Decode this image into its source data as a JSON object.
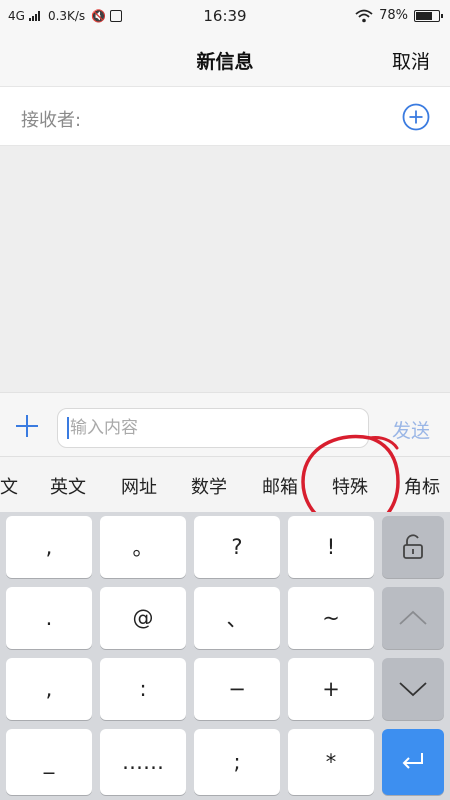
{
  "status_bar": {
    "network": "4G",
    "speed": "0.3K/s",
    "time": "16:39",
    "battery_percent": "78%",
    "battery_level": 0.78
  },
  "nav": {
    "title": "新信息",
    "cancel": "取消"
  },
  "recipient": {
    "label": "接收者:"
  },
  "composer": {
    "placeholder": "输入内容",
    "send": "发送"
  },
  "categories": [
    "文",
    "英文",
    "网址",
    "数学",
    "邮箱",
    "特殊",
    "角标"
  ],
  "keyboard": {
    "rows": [
      [
        ",",
        "。",
        "?",
        "!"
      ],
      [
        ".",
        "@",
        "、",
        "~"
      ],
      [
        ",",
        ":",
        "−",
        "+"
      ],
      [
        "_",
        "……",
        ";",
        "*"
      ]
    ],
    "side_keys": [
      "lock-icon",
      "arrow-up-icon",
      "arrow-down-icon",
      "return-icon"
    ]
  },
  "colors": {
    "accent": "#3a7be0",
    "send_disabled": "#9ab6e6",
    "annotation_red": "#d81e2e",
    "return_key": "#3d8ff0",
    "keyboard_bg": "#d6d8dc"
  }
}
